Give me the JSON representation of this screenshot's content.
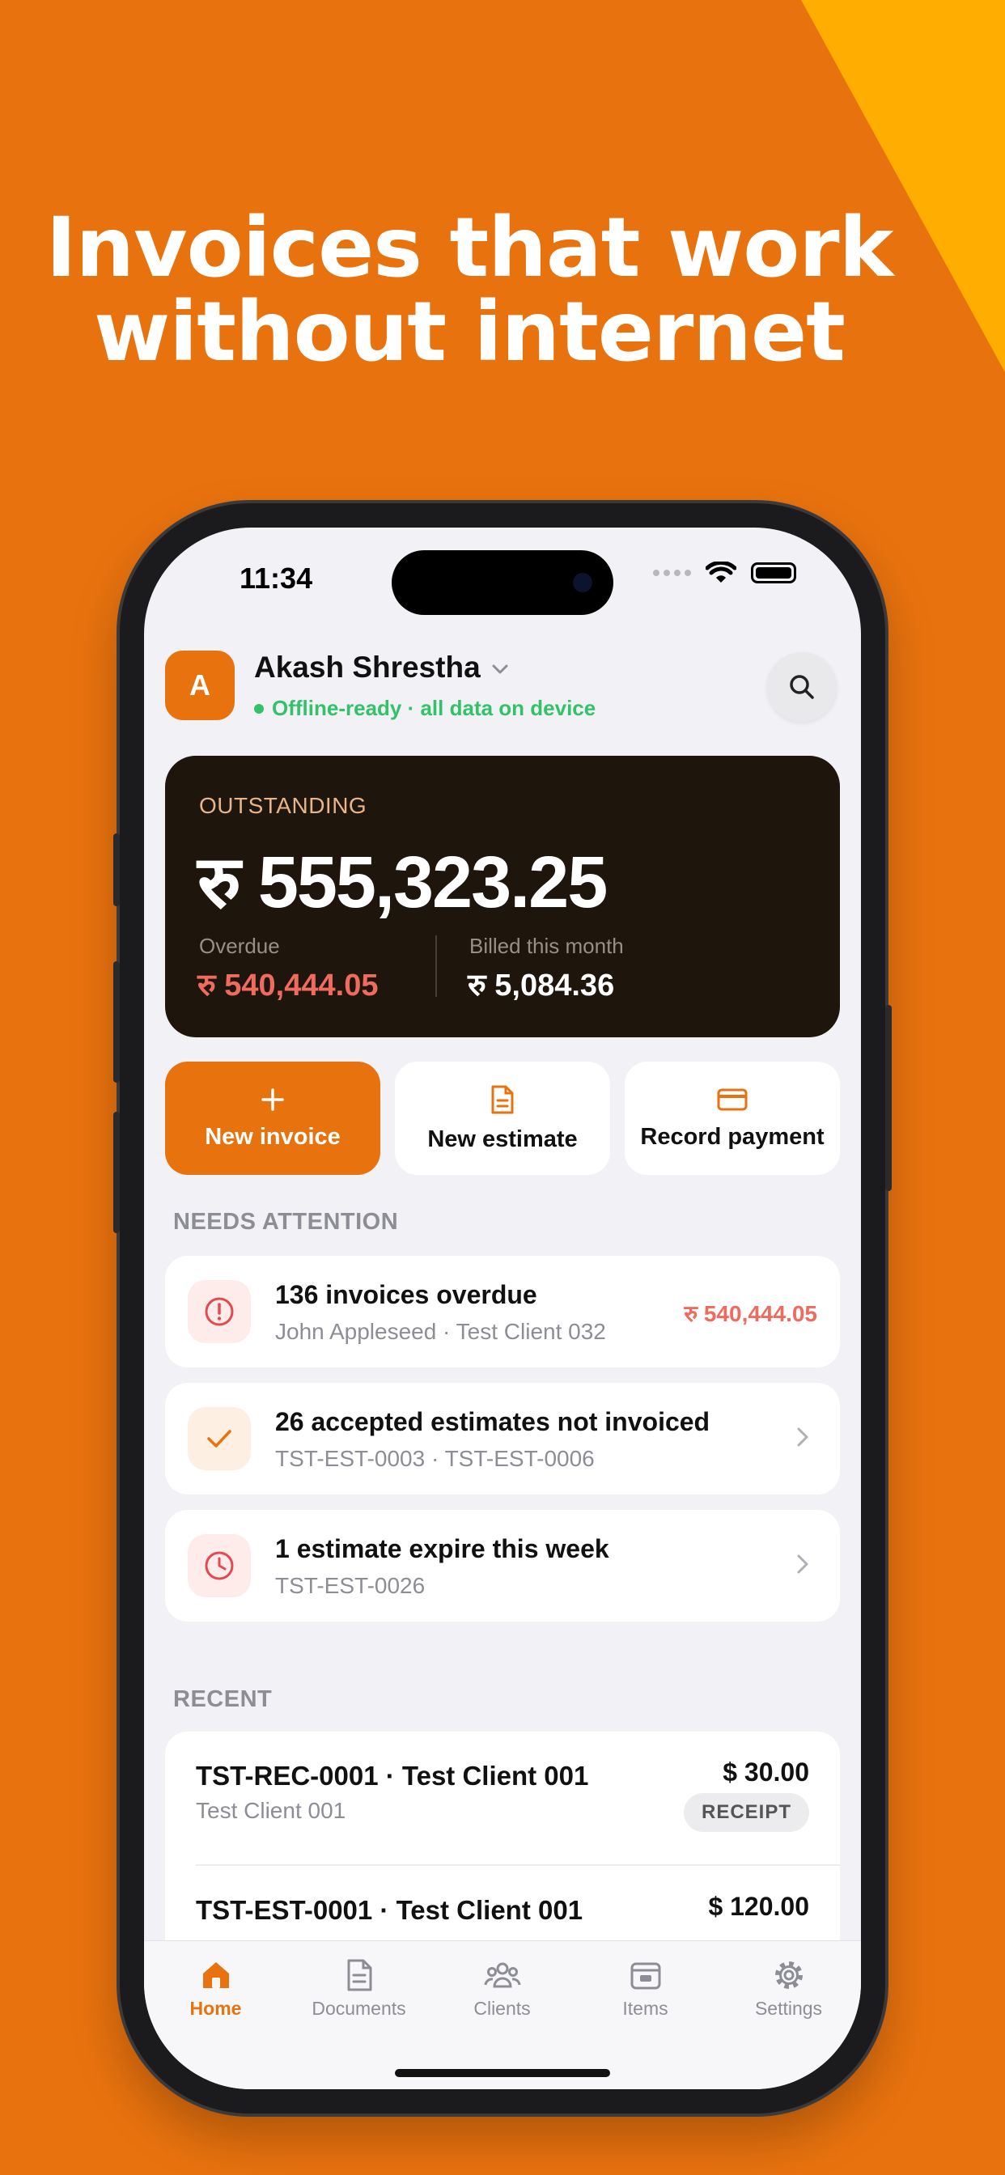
{
  "headline": {
    "line1": "Invoices that work",
    "line2": "without internet"
  },
  "colors": {
    "brand": "#E8720E",
    "accent_corner": "#FFAE00",
    "success": "#33C16A",
    "danger": "#EE6B5E"
  },
  "status_bar": {
    "time": "11:34"
  },
  "account": {
    "avatar_letter": "A",
    "name": "Akash Shrestha",
    "status": "Offline-ready · all data on device"
  },
  "summary": {
    "label": "OUTSTANDING",
    "amount": "रु 555,323.25",
    "overdue_label": "Overdue",
    "overdue_value": "रु 540,444.05",
    "billed_label": "Billed this month",
    "billed_value": "रु 5,084.36"
  },
  "actions": [
    {
      "label": "New invoice",
      "icon": "plus-icon"
    },
    {
      "label": "New estimate",
      "icon": "document-icon"
    },
    {
      "label": "Record payment",
      "icon": "card-icon"
    }
  ],
  "attention": {
    "title": "NEEDS ATTENTION",
    "items": [
      {
        "title": "136 invoices overdue",
        "sub": "John Appleseed · Test Client 032",
        "amount": "रु 540,444.05",
        "icon": "alert-icon"
      },
      {
        "title": "26 accepted estimates not invoiced",
        "sub": "TST-EST-0003 · TST-EST-0006",
        "icon": "check-icon"
      },
      {
        "title": "1 estimate expire this week",
        "sub": "TST-EST-0026",
        "icon": "clock-icon"
      }
    ]
  },
  "recent": {
    "title": "RECENT",
    "items": [
      {
        "title": "TST-REC-0001 · Test Client 001",
        "sub": "Test Client 001",
        "amount": "$ 30.00",
        "badge": "RECEIPT"
      },
      {
        "title": "TST-EST-0001 · Test Client 001",
        "amount": "$ 120.00"
      }
    ]
  },
  "tabs": [
    {
      "label": "Home",
      "icon": "home-icon",
      "active": true
    },
    {
      "label": "Documents",
      "icon": "document-icon"
    },
    {
      "label": "Clients",
      "icon": "clients-icon"
    },
    {
      "label": "Items",
      "icon": "items-icon"
    },
    {
      "label": "Settings",
      "icon": "gear-icon"
    }
  ]
}
